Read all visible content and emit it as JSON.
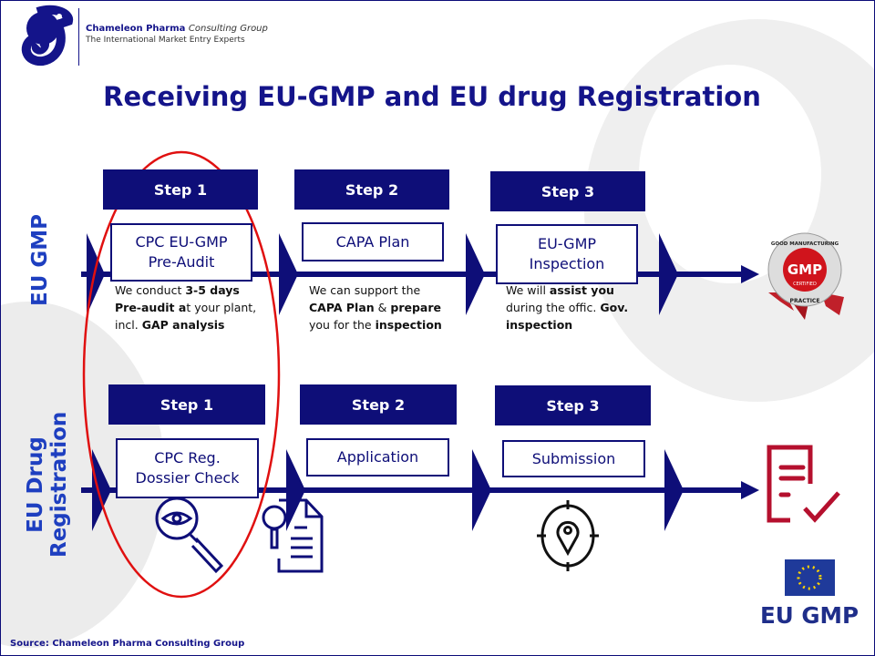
{
  "header": {
    "company_name": "Chameleon Pharma",
    "company_name_suffix": "Consulting Group",
    "tagline": "The International Market Entry Experts"
  },
  "title": "Receiving EU-GMP and EU drug Registration",
  "rows": [
    {
      "label": "EU GMP",
      "steps": [
        {
          "step": "Step 1",
          "box": [
            "CPC EU-GMP",
            "Pre-Audit"
          ],
          "desc": [
            [
              "We conduct ",
              false
            ],
            [
              "3-5 days",
              true
            ],
            [
              "Pre-audit a",
              true
            ],
            [
              "t your plant, incl. ",
              false
            ],
            [
              "GAP analysis",
              true
            ]
          ]
        },
        {
          "step": "Step 2",
          "box": [
            "CAPA Plan"
          ],
          "desc": [
            [
              "We can support the ",
              false
            ],
            [
              "CAPA Plan",
              true
            ],
            [
              " & ",
              false
            ],
            [
              "prepare",
              true
            ],
            [
              " you for the ",
              false
            ],
            [
              "inspection",
              true
            ]
          ]
        },
        {
          "step": "Step 3",
          "box": [
            "EU-GMP",
            "Inspection"
          ],
          "desc": [
            [
              "We will ",
              false
            ],
            [
              "assist you",
              true
            ],
            [
              " during the offic. ",
              false
            ],
            [
              "Gov. inspection",
              true
            ]
          ]
        }
      ],
      "end_icon": "gmp-certified-badge"
    },
    {
      "label": [
        "EU Drug",
        "Registration"
      ],
      "steps": [
        {
          "step": "Step 1",
          "box": [
            "CPC Reg.",
            "Dossier Check"
          ],
          "icon": "magnifier-eye-icon"
        },
        {
          "step": "Step 2",
          "box": [
            "Application"
          ],
          "icon": "document-search-icon"
        },
        {
          "step": "Step 3",
          "box": [
            "Submission"
          ],
          "icon": "location-target-icon"
        }
      ],
      "end_icon": "document-check-icon"
    }
  ],
  "badge": {
    "lines": [
      "GOOD MANUFACTURING",
      "GMP",
      "CERTIFIED",
      "PRACTICE"
    ]
  },
  "eu_logo": "EU GMP",
  "footer": "Source: Chameleon Pharma Consulting Group",
  "colors": {
    "navy": "#0e0e78",
    "title": "#14148a",
    "side_label": "#1e3fc0",
    "highlight": "#e01010",
    "accent_red": "#b5102e"
  }
}
